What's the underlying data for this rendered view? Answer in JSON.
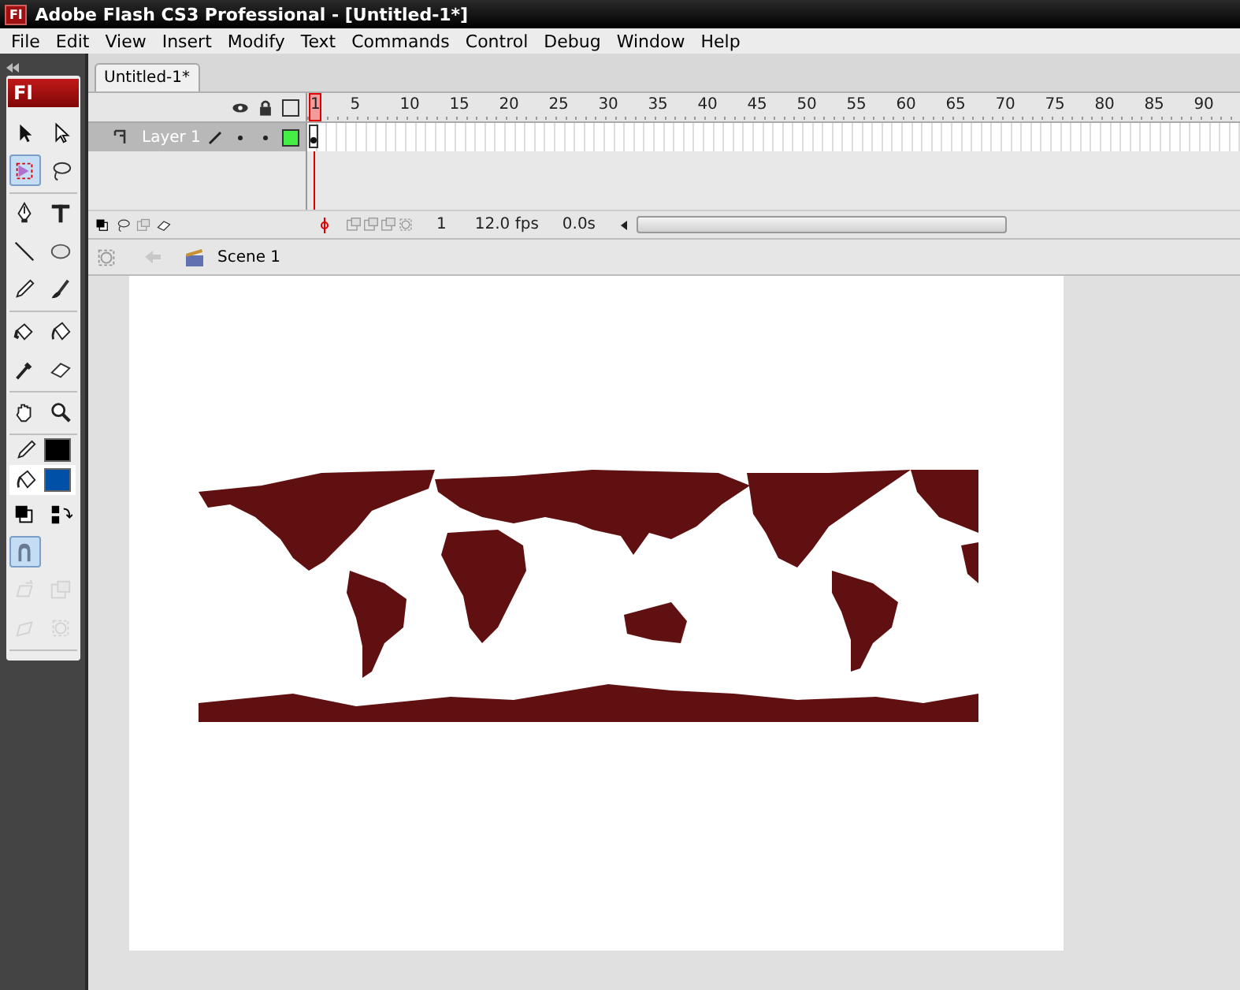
{
  "window": {
    "app_icon": "Fl",
    "title": "Adobe Flash CS3 Professional - [Untitled-1*]"
  },
  "menu": [
    "File",
    "Edit",
    "View",
    "Insert",
    "Modify",
    "Text",
    "Commands",
    "Control",
    "Debug",
    "Window",
    "Help"
  ],
  "toolbox": {
    "logo": "Fl",
    "tool_groups": [
      [
        {
          "kind": "selection",
          "selected": false,
          "disabled": false
        },
        {
          "kind": "subselection",
          "selected": false,
          "disabled": false
        },
        {
          "kind": "free-transform",
          "selected": true,
          "disabled": false
        },
        {
          "kind": "lasso",
          "selected": false,
          "disabled": false
        }
      ],
      [
        {
          "kind": "pen",
          "selected": false,
          "disabled": false
        },
        {
          "kind": "text",
          "selected": false,
          "disabled": false
        },
        {
          "kind": "line",
          "selected": false,
          "disabled": false
        },
        {
          "kind": "oval",
          "selected": false,
          "disabled": false
        },
        {
          "kind": "pencil",
          "selected": false,
          "disabled": false
        },
        {
          "kind": "brush",
          "selected": false,
          "disabled": false
        }
      ],
      [
        {
          "kind": "ink-bottle",
          "selected": false,
          "disabled": false
        },
        {
          "kind": "paint-bucket",
          "selected": false,
          "disabled": false
        },
        {
          "kind": "eyedropper",
          "selected": false,
          "disabled": false
        },
        {
          "kind": "eraser",
          "selected": false,
          "disabled": false
        }
      ],
      [
        {
          "kind": "hand",
          "selected": false,
          "disabled": false
        },
        {
          "kind": "zoom",
          "selected": false,
          "disabled": false
        }
      ]
    ],
    "colors": [
      {
        "kind": "stroke",
        "color": "#000000",
        "selected": false
      },
      {
        "kind": "fill",
        "color": "#0050a8",
        "selected": true
      }
    ],
    "options": [
      {
        "kind": "default-colors",
        "selected": false,
        "disabled": false
      },
      {
        "kind": "swap-colors",
        "selected": false,
        "disabled": false
      },
      {
        "kind": "snap",
        "selected": true,
        "disabled": false
      },
      {
        "kind": "smooth",
        "selected": false,
        "disabled": true
      },
      {
        "kind": "straighten",
        "selected": false,
        "disabled": true
      },
      {
        "kind": "rotate",
        "selected": false,
        "disabled": true
      },
      {
        "kind": "scale",
        "selected": false,
        "disabled": true
      }
    ]
  },
  "document_tabs": [
    {
      "label": "Untitled-1*",
      "selected": true
    }
  ],
  "timeline": {
    "frame_numbers": [
      "1",
      "5",
      "10",
      "15",
      "20",
      "25",
      "30",
      "35",
      "40",
      "45",
      "50",
      "55",
      "60",
      "65",
      "70",
      "75",
      "80",
      "85",
      "90"
    ],
    "layers": [
      {
        "name": "Layer 1",
        "selected": true,
        "color": "#44ee44"
      }
    ],
    "current_frame": "1",
    "frame_rate": "12.0 fps",
    "elapsed_time": "0.0s"
  },
  "edit_bar": {
    "scene": "Scene 1"
  }
}
